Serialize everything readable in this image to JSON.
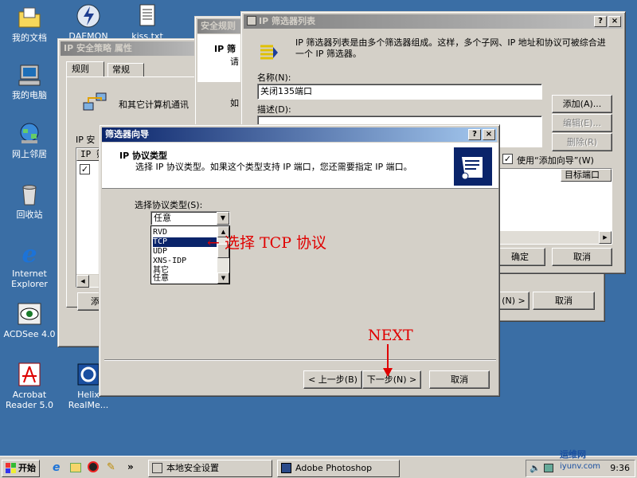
{
  "desktop": {
    "icons": [
      {
        "label": "我的文档",
        "icon": "folder-documents-icon"
      },
      {
        "label": "我的电脑",
        "icon": "my-computer-icon"
      },
      {
        "label": "网上邻居",
        "icon": "network-places-icon"
      },
      {
        "label": "回收站",
        "icon": "recycle-bin-icon"
      },
      {
        "label": "Internet Explorer",
        "icon": "internet-explorer-icon"
      },
      {
        "label": "ACDSee 4.0",
        "icon": "acdsee-icon"
      },
      {
        "label": "Acrobat Reader 5.0",
        "icon": "acrobat-icon"
      },
      {
        "label": "DAEMON Tools",
        "icon": "daemon-tools-icon"
      },
      {
        "label": "kiss.txt",
        "icon": "text-file-icon"
      },
      {
        "label": "Helix RealMe...",
        "icon": "helix-real-icon"
      }
    ]
  },
  "policy_window": {
    "title": "IP 安全策略 属性",
    "tabs": [
      "规则",
      "常规"
    ],
    "description": "和其它计算机通讯",
    "list_label": "IP 安",
    "col": "IP 筛",
    "add_button": "添加"
  },
  "rule_window": {
    "title": "安全规则",
    "heading": "IP 筛",
    "line": "请",
    "line2": "如"
  },
  "filter_list_window": {
    "title": "IP 筛选器列表",
    "help": "?",
    "close": "×",
    "description": "IP 筛选器列表是由多个筛选器组成。这样，多个子网、IP 地址和协议可被综合进一个 IP 筛选器。",
    "name_label": "名称(N):",
    "name_value": "关闭135端口",
    "desc_label": "描述(D):",
    "add_button": "添加(A)...",
    "edit_button": "编辑(E)...",
    "delete_button": "删除(R)",
    "use_wizard_label": "使用“添加向导”(W)",
    "use_wizard_checked": true,
    "target_port_col": "目标端口",
    "ok_button": "确定",
    "cancel_button": "取消"
  },
  "back_buttons": {
    "next_fragment": "(N) >",
    "cancel": "取消"
  },
  "wizard": {
    "title": "筛选器向导",
    "help": "?",
    "close": "×",
    "header_title": "IP 协议类型",
    "header_desc": "选择 IP 协议类型。如果这个类型支持 IP 端口，您还需要指定 IP 端口。",
    "select_label": "选择协议类型(S):",
    "selected_value": "任意",
    "options": [
      "RVD",
      "TCP",
      "UDP",
      "XNS-IDP",
      "其它",
      "任意"
    ],
    "highlighted_option": "TCP",
    "back_button": "< 上一步(B)",
    "next_button": "下一步(N) >",
    "cancel_button": "取消"
  },
  "annotations": {
    "tcp_note": "← 选择 TCP 协议",
    "next_note": "NEXT",
    "color": "#e00000"
  },
  "taskbar": {
    "start": "开始",
    "tasks": [
      "本地安全设置",
      "Adobe Photoshop"
    ],
    "clock": "9:36",
    "watermark": "运维网",
    "watermark_url": "iyunv.com"
  }
}
